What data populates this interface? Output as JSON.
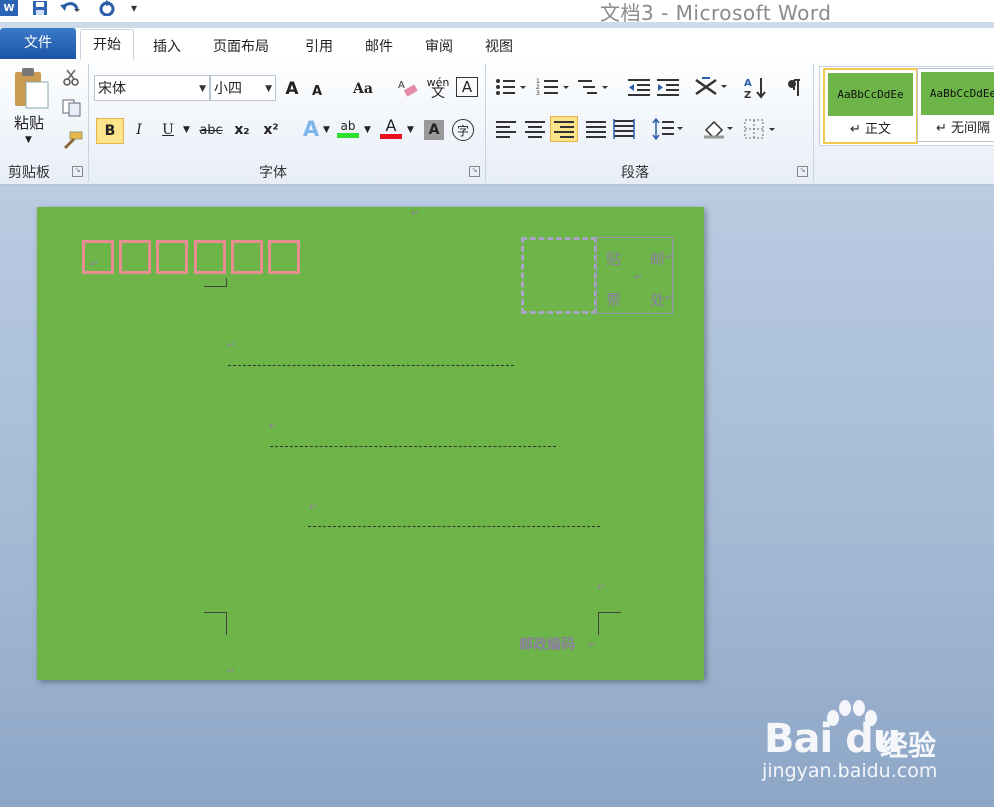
{
  "window": {
    "title": "文档3 - Microsoft Word"
  },
  "quick_access": {
    "app_icon": "W",
    "save_icon": "floppy-icon",
    "undo_icon": "undo-icon",
    "redo_icon": "redo-icon",
    "customize": "▾"
  },
  "tabs": [
    {
      "label": "文件"
    },
    {
      "label": "开始"
    },
    {
      "label": "插入"
    },
    {
      "label": "页面布局"
    },
    {
      "label": "引用"
    },
    {
      "label": "邮件"
    },
    {
      "label": "审阅"
    },
    {
      "label": "视图"
    }
  ],
  "clipboard": {
    "paste_label": "粘贴",
    "group_label": "剪贴板"
  },
  "font": {
    "font_name": "宋体",
    "font_size": "小四",
    "group_label": "字体",
    "bold": "B",
    "italic": "I",
    "underline": "U",
    "strike": "abc",
    "sub": "x₂",
    "sup": "x²",
    "grow": "A",
    "shrink": "A",
    "case": "Aa",
    "clear_icon": "eraser-icon",
    "phonetic": "wén",
    "border_char": "A",
    "highlight": "ab",
    "font_color": "A",
    "shade_char": "A",
    "enclose_char": "字"
  },
  "paragraph": {
    "group_label": "段落"
  },
  "styles": [
    {
      "preview": "AaBbCcDdEe",
      "name": "↵ 正文"
    },
    {
      "preview": "AaBbCcDdEe",
      "name": "↵ 无间隔"
    }
  ],
  "document": {
    "stamp_chars": [
      "贴",
      "邮",
      "票",
      "处"
    ],
    "postcode_label": "邮政编码",
    "para_mark": "↵"
  },
  "watermark": {
    "logo": "Bai du",
    "jingyan": "经验",
    "url": "jingyan.baidu.com"
  },
  "colors": {
    "page": "#6db548",
    "zip_box": "#e88d92",
    "stamp": "#a8a4c4",
    "file_tab": "#2b64b5"
  }
}
